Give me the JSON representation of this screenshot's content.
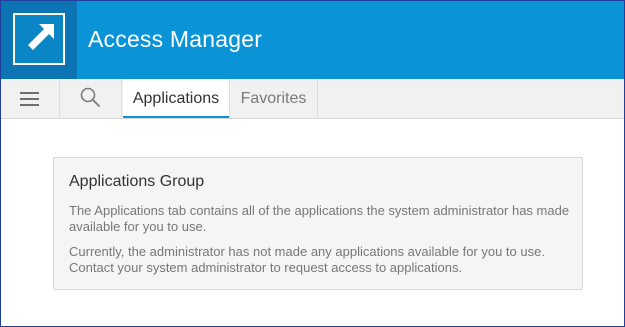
{
  "header": {
    "title": "Access Manager",
    "logo_icon": "arrow-up-left-icon",
    "colors": {
      "header_bg": "#0a93d6",
      "logo_bg": "#0d74b3"
    }
  },
  "toolbar": {
    "menu_icon": "hamburger-menu-icon",
    "search_icon": "search-icon",
    "tabs": [
      {
        "label": "Applications",
        "active": true
      },
      {
        "label": "Favorites",
        "active": false
      }
    ],
    "accent_color": "#0a93d6"
  },
  "main": {
    "card": {
      "title": "Applications Group",
      "paragraphs": [
        "The Applications tab contains all of the applications the system administrator has made available for you to use.",
        "Currently, the administrator has not made any applications available for you to use. Contact your system administrator to request access to applications."
      ]
    }
  }
}
